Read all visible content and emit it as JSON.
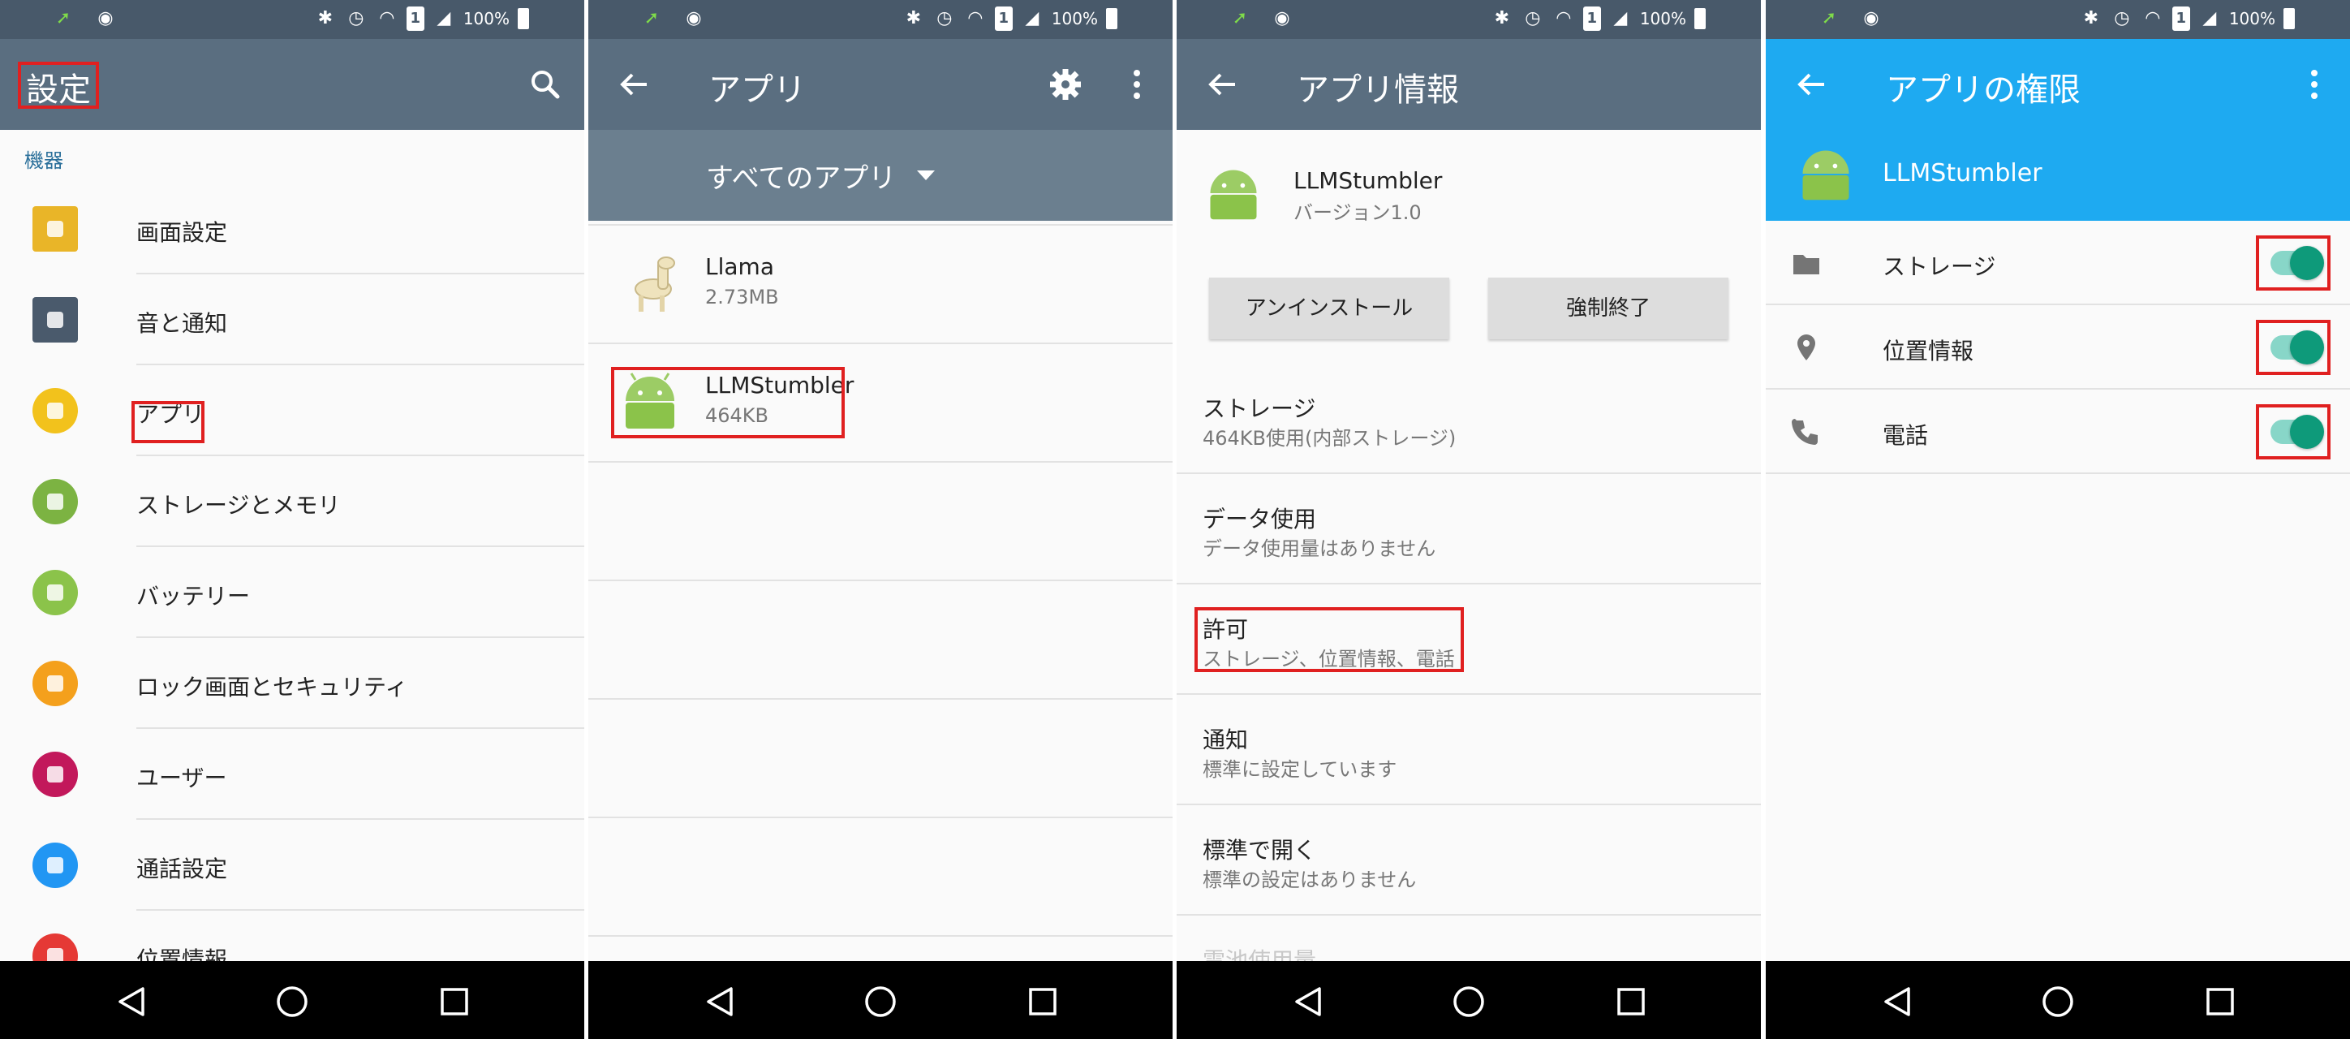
{
  "status_bar": {
    "battery": "100%",
    "sim_slot": "1"
  },
  "nav_bar": {
    "back": "back-icon",
    "home": "home-icon",
    "recents": "recents-icon"
  },
  "screen1": {
    "title": "設定",
    "section": "機器",
    "items": [
      {
        "label": "画面設定",
        "icon": "display-icon",
        "color": "#e9b528"
      },
      {
        "label": "音と通知",
        "icon": "sound-icon",
        "color": "#4a5a6c"
      },
      {
        "label": "アプリ",
        "icon": "apps-icon",
        "color": "#f2c21c"
      },
      {
        "label": "ストレージとメモリ",
        "icon": "storage-icon",
        "color": "#7cb342"
      },
      {
        "label": "バッテリー",
        "icon": "battery-icon",
        "color": "#8bc34a"
      },
      {
        "label": "ロック画面とセキュリティ",
        "icon": "lock-icon",
        "color": "#f4a01c"
      },
      {
        "label": "ユーザー",
        "icon": "users-icon",
        "color": "#c2185b"
      },
      {
        "label": "通話設定",
        "icon": "phone-icon",
        "color": "#2196f3"
      },
      {
        "label": "位置情報",
        "icon": "location-icon",
        "color": "#e53935"
      }
    ]
  },
  "screen2": {
    "title": "アプリ",
    "filter": "すべてのアプリ",
    "apps": [
      {
        "name": "Llama",
        "size": "2.73MB"
      },
      {
        "name": "LLMStumbler",
        "size": "464KB"
      }
    ]
  },
  "screen3": {
    "title": "アプリ情報",
    "app_name": "LLMStumbler",
    "version": "バージョン1.0",
    "uninstall": "アンインストール",
    "force_stop": "強制終了",
    "rows": [
      {
        "title": "ストレージ",
        "sub": "464KB使用(内部ストレージ)"
      },
      {
        "title": "データ使用",
        "sub": "データ使用量はありません"
      },
      {
        "title": "許可",
        "sub": "ストレージ、位置情報、電話"
      },
      {
        "title": "通知",
        "sub": "標準に設定しています"
      },
      {
        "title": "標準で開く",
        "sub": "標準の設定はありません"
      },
      {
        "title": "電池使用量",
        "sub": ""
      }
    ]
  },
  "screen4": {
    "title": "アプリの権限",
    "app_name": "LLMStumbler",
    "accent": "#1eaaf1",
    "permissions": [
      {
        "label": "ストレージ",
        "icon": "folder-icon",
        "enabled": true
      },
      {
        "label": "位置情報",
        "icon": "location-pin-icon",
        "enabled": true
      },
      {
        "label": "電話",
        "icon": "phone-handset-icon",
        "enabled": true
      }
    ]
  }
}
